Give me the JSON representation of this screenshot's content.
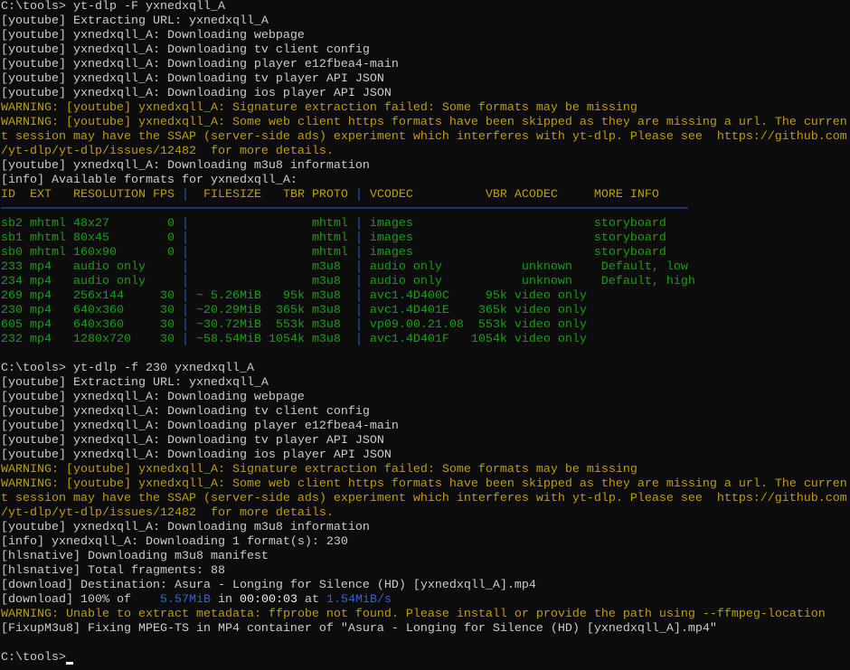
{
  "terminal": {
    "lines": [
      [
        {
          "t": "C:\\tools> yt-dlp -F yxnedxqll_A",
          "c": "gray"
        }
      ],
      [
        {
          "t": "[youtube] Extracting URL: yxnedxqll_A",
          "c": "gray"
        }
      ],
      [
        {
          "t": "[youtube] yxnedxqll_A: Downloading webpage",
          "c": "gray"
        }
      ],
      [
        {
          "t": "[youtube] yxnedxqll_A: Downloading tv client config",
          "c": "gray"
        }
      ],
      [
        {
          "t": "[youtube] yxnedxqll_A: Downloading player e12fbea4-main",
          "c": "gray"
        }
      ],
      [
        {
          "t": "[youtube] yxnedxqll_A: Downloading tv player API JSON",
          "c": "gray"
        }
      ],
      [
        {
          "t": "[youtube] yxnedxqll_A: Downloading ios player API JSON",
          "c": "gray"
        }
      ],
      [
        {
          "t": "WARNING:",
          "c": "yellow"
        },
        {
          "t": " [youtube] yxnedxqll_A: Signature extraction failed: Some formats may be missing",
          "c": "yellow"
        }
      ],
      [
        {
          "t": "WARNING:",
          "c": "yellow"
        },
        {
          "t": " [youtube] yxnedxqll_A: Some web client https formats have been skipped as they are missing a url. The curren",
          "c": "yellow"
        }
      ],
      [
        {
          "t": "t session may have the SSAP (server-side ads) experiment which interferes with yt-dlp. Please see  https://github.com",
          "c": "yellow"
        }
      ],
      [
        {
          "t": "/yt-dlp/yt-dlp/issues/12482  for more details.",
          "c": "yellow"
        }
      ],
      [
        {
          "t": "[youtube] yxnedxqll_A: Downloading m3u8 information",
          "c": "gray"
        }
      ],
      [
        {
          "t": "[info] Available formats for yxnedxqll_A:",
          "c": "gray"
        }
      ],
      [
        {
          "t": "ID  EXT   RESOLUTION FPS ",
          "c": "yellow"
        },
        {
          "t": "│",
          "c": "blue"
        },
        {
          "t": "  FILESIZE   TBR PROTO ",
          "c": "yellow"
        },
        {
          "t": "│",
          "c": "blue"
        },
        {
          "t": " VCODEC          VBR ACODEC     MORE INFO",
          "c": "yellow"
        }
      ],
      [
        {
          "t": "───────────────────────────────────────────────────────────────────────────────────────────────",
          "c": "blue"
        }
      ],
      [
        {
          "t": "sb2 mhtml 48x27        0 ",
          "c": "green"
        },
        {
          "t": "│",
          "c": "blue"
        },
        {
          "t": "                 mhtml ",
          "c": "green"
        },
        {
          "t": "│",
          "c": "blue"
        },
        {
          "t": " images                         storyboard",
          "c": "green"
        }
      ],
      [
        {
          "t": "sb1 mhtml 80x45        0 ",
          "c": "green"
        },
        {
          "t": "│",
          "c": "blue"
        },
        {
          "t": "                 mhtml ",
          "c": "green"
        },
        {
          "t": "│",
          "c": "blue"
        },
        {
          "t": " images                         storyboard",
          "c": "green"
        }
      ],
      [
        {
          "t": "sb0 mhtml 160x90       0 ",
          "c": "green"
        },
        {
          "t": "│",
          "c": "blue"
        },
        {
          "t": "                 mhtml ",
          "c": "green"
        },
        {
          "t": "│",
          "c": "blue"
        },
        {
          "t": " images                         storyboard",
          "c": "green"
        }
      ],
      [
        {
          "t": "233 mp4   audio only     ",
          "c": "green"
        },
        {
          "t": "│",
          "c": "blue"
        },
        {
          "t": "                 m3u8  ",
          "c": "green"
        },
        {
          "t": "│",
          "c": "blue"
        },
        {
          "t": " audio only           unknown    Default, low",
          "c": "green"
        }
      ],
      [
        {
          "t": "234 mp4   audio only     ",
          "c": "green"
        },
        {
          "t": "│",
          "c": "blue"
        },
        {
          "t": "                 m3u8  ",
          "c": "green"
        },
        {
          "t": "│",
          "c": "blue"
        },
        {
          "t": " audio only           unknown    Default, high",
          "c": "green"
        }
      ],
      [
        {
          "t": "269 mp4   256x144     30 ",
          "c": "green"
        },
        {
          "t": "│",
          "c": "blue"
        },
        {
          "t": " ~ 5.26MiB   95k m3u8  ",
          "c": "green"
        },
        {
          "t": "│",
          "c": "blue"
        },
        {
          "t": " avc1.4D400C     95k video only",
          "c": "green"
        }
      ],
      [
        {
          "t": "230 mp4   640x360     30 ",
          "c": "green"
        },
        {
          "t": "│",
          "c": "blue"
        },
        {
          "t": " ~20.29MiB  365k m3u8  ",
          "c": "green"
        },
        {
          "t": "│",
          "c": "blue"
        },
        {
          "t": " avc1.4D401E    365k video only",
          "c": "green"
        }
      ],
      [
        {
          "t": "605 mp4   640x360     30 ",
          "c": "green"
        },
        {
          "t": "│",
          "c": "blue"
        },
        {
          "t": " ~30.72MiB  553k m3u8  ",
          "c": "green"
        },
        {
          "t": "│",
          "c": "blue"
        },
        {
          "t": " vp09.00.21.08  553k video only",
          "c": "green"
        }
      ],
      [
        {
          "t": "232 mp4   1280x720    30 ",
          "c": "green"
        },
        {
          "t": "│",
          "c": "blue"
        },
        {
          "t": " ~58.54MiB 1054k m3u8  ",
          "c": "green"
        },
        {
          "t": "│",
          "c": "blue"
        },
        {
          "t": " avc1.4D401F   1054k video only",
          "c": "green"
        }
      ],
      [
        {
          "t": "",
          "c": "gray"
        }
      ],
      [
        {
          "t": "C:\\tools> yt-dlp -f 230 yxnedxqll_A",
          "c": "gray"
        }
      ],
      [
        {
          "t": "[youtube] Extracting URL: yxnedxqll_A",
          "c": "gray"
        }
      ],
      [
        {
          "t": "[youtube] yxnedxqll_A: Downloading webpage",
          "c": "gray"
        }
      ],
      [
        {
          "t": "[youtube] yxnedxqll_A: Downloading tv client config",
          "c": "gray"
        }
      ],
      [
        {
          "t": "[youtube] yxnedxqll_A: Downloading player e12fbea4-main",
          "c": "gray"
        }
      ],
      [
        {
          "t": "[youtube] yxnedxqll_A: Downloading tv player API JSON",
          "c": "gray"
        }
      ],
      [
        {
          "t": "[youtube] yxnedxqll_A: Downloading ios player API JSON",
          "c": "gray"
        }
      ],
      [
        {
          "t": "WARNING:",
          "c": "yellow"
        },
        {
          "t": " [youtube] yxnedxqll_A: Signature extraction failed: Some formats may be missing",
          "c": "yellow"
        }
      ],
      [
        {
          "t": "WARNING:",
          "c": "yellow"
        },
        {
          "t": " [youtube] yxnedxqll_A: Some web client https formats have been skipped as they are missing a url. The curren",
          "c": "yellow"
        }
      ],
      [
        {
          "t": "t session may have the SSAP (server-side ads) experiment which interferes with yt-dlp. Please see  https://github.com",
          "c": "yellow"
        }
      ],
      [
        {
          "t": "/yt-dlp/yt-dlp/issues/12482  for more details.",
          "c": "yellow"
        }
      ],
      [
        {
          "t": "[youtube] yxnedxqll_A: Downloading m3u8 information",
          "c": "gray"
        }
      ],
      [
        {
          "t": "[info] yxnedxqll_A: Downloading 1 format(s): 230",
          "c": "gray"
        }
      ],
      [
        {
          "t": "[hlsnative] Downloading m3u8 manifest",
          "c": "gray"
        }
      ],
      [
        {
          "t": "[hlsnative] Total fragments: 88",
          "c": "gray"
        }
      ],
      [
        {
          "t": "[download] Destination: Asura - Longing for Silence (HD) [yxnedxqll_A].mp4",
          "c": "gray"
        }
      ],
      [
        {
          "t": "[download] 100% of    ",
          "c": "gray"
        },
        {
          "t": "5.57MiB",
          "c": "blue"
        },
        {
          "t": " in ",
          "c": "gray"
        },
        {
          "t": "00:00:03",
          "c": "white"
        },
        {
          "t": " at ",
          "c": "gray"
        },
        {
          "t": "1.54MiB/s",
          "c": "blue"
        }
      ],
      [
        {
          "t": "WARNING:",
          "c": "yellow"
        },
        {
          "t": " Unable to extract metadata: ffprobe not found. Please install or provide the path using --ffmpeg-location",
          "c": "yellow"
        }
      ],
      [
        {
          "t": "[FixupM3u8] Fixing MPEG-TS in MP4 container of \"Asura - Longing for Silence (HD) [yxnedxqll_A].mp4\"",
          "c": "gray"
        }
      ],
      [
        {
          "t": "",
          "c": "gray"
        }
      ],
      [
        {
          "t": "C:\\tools>",
          "c": "gray"
        }
      ]
    ]
  }
}
